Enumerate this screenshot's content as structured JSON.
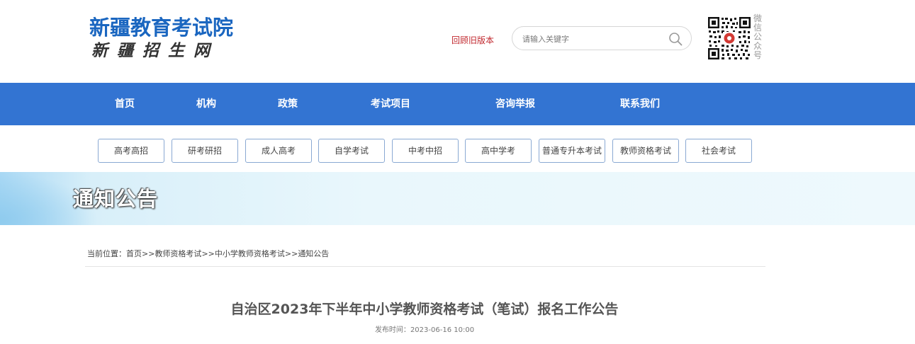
{
  "header": {
    "logo_title": "新疆教育考试院",
    "logo_subtitle": "新疆招生网",
    "old_version_label": "回顾旧版本",
    "search": {
      "placeholder": "请输入关键字",
      "value": ""
    },
    "qr_label": "微信公众号"
  },
  "nav": {
    "items": [
      {
        "label": "首页"
      },
      {
        "label": "机构"
      },
      {
        "label": "政策"
      },
      {
        "label": "考试项目"
      },
      {
        "label": "咨询举报"
      },
      {
        "label": "联系我们"
      }
    ]
  },
  "subnav": {
    "items": [
      {
        "label": "高考高招"
      },
      {
        "label": "研考研招"
      },
      {
        "label": "成人高考"
      },
      {
        "label": "自学考试"
      },
      {
        "label": "中考中招"
      },
      {
        "label": "高中学考"
      },
      {
        "label": "普通专升本考试"
      },
      {
        "label": "教师资格考试"
      },
      {
        "label": "社会考试"
      }
    ]
  },
  "banner": {
    "title": "通知公告"
  },
  "breadcrumb": {
    "prefix": "当前位置：",
    "items": [
      "首页",
      "教师资格考试",
      "中小学教师资格考试",
      "通知公告"
    ],
    "separator": ">>"
  },
  "article": {
    "title": "自治区2023年下半年中小学教师资格考试（笔试）报名工作公告",
    "publish_label": "发布时间：",
    "publish_time": "2023-06-16 10:00"
  },
  "colors": {
    "brand_blue": "#1a66c0",
    "nav_blue": "#3374d2",
    "accent_red": "#c0272d"
  }
}
